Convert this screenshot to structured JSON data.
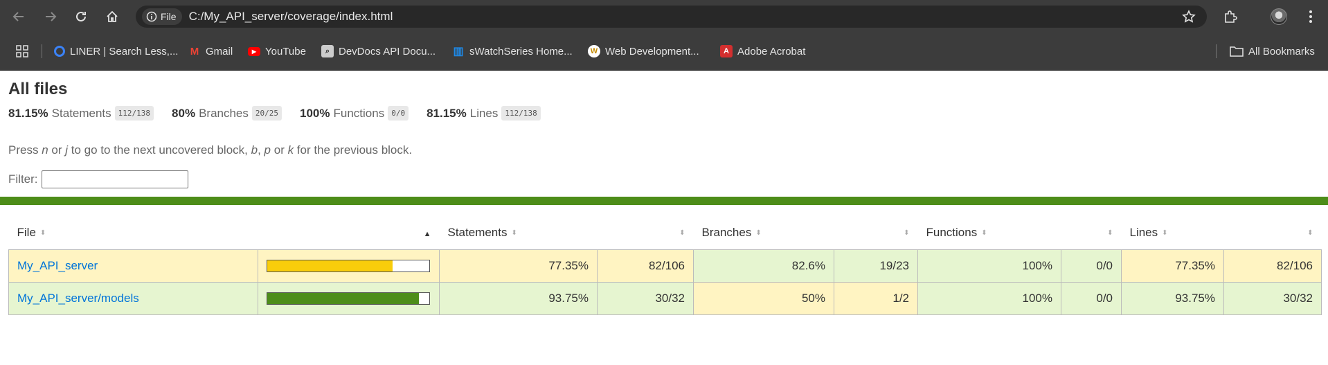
{
  "browser": {
    "url": "C:/My_API_server/coverage/index.html",
    "site_chip": "File",
    "bookmarks": [
      {
        "label": "LINER | Search Less,...",
        "icon": "liner-icon",
        "color": "#3b82f6"
      },
      {
        "label": "Gmail",
        "icon": "gmail-icon",
        "color": "#ea4335"
      },
      {
        "label": "YouTube",
        "icon": "youtube-icon",
        "color": "#ff0000"
      },
      {
        "label": "DevDocs API Docu...",
        "icon": "devdocs-icon",
        "color": "#cccccc"
      },
      {
        "label": "sWatchSeries Home...",
        "icon": "swatchseries-icon",
        "color": "#1e88e5"
      },
      {
        "label": "Web Development...",
        "icon": "webdev-icon",
        "color": "#f4c20d"
      },
      {
        "label": "Adobe Acrobat",
        "icon": "acrobat-icon",
        "color": "#d32f2f"
      }
    ],
    "all_bookmarks": "All Bookmarks"
  },
  "report": {
    "title": "All files",
    "summary": [
      {
        "pct": "81.15%",
        "label": "Statements",
        "fraction": "112/138"
      },
      {
        "pct": "80%",
        "label": "Branches",
        "fraction": "20/25"
      },
      {
        "pct": "100%",
        "label": "Functions",
        "fraction": "0/0"
      },
      {
        "pct": "81.15%",
        "label": "Lines",
        "fraction": "112/138"
      }
    ],
    "hint": {
      "p1": "Press ",
      "k1": "n",
      "p2": " or ",
      "k2": "j",
      "p3": " to go to the next uncovered block, ",
      "k3": "b",
      "p4": ", ",
      "k4": "p",
      "p5": " or ",
      "k5": "k",
      "p6": " for the previous block."
    },
    "filter_label": "Filter:",
    "filter_value": "",
    "columns": {
      "file": "File",
      "sort_up": "▲",
      "statements": "Statements",
      "branches": "Branches",
      "functions": "Functions",
      "lines": "Lines"
    },
    "rows": [
      {
        "file": "My_API_server",
        "stmt_pct": "77.35%",
        "stmt_frac": "82/106",
        "branch_pct": "82.6%",
        "branch_frac": "19/23",
        "func_pct": "100%",
        "func_frac": "0/0",
        "line_pct": "77.35%",
        "line_frac": "82/106",
        "coverage_fraction": 0.7735
      },
      {
        "file": "My_API_server/models",
        "stmt_pct": "93.75%",
        "stmt_frac": "30/32",
        "branch_pct": "50%",
        "branch_frac": "1/2",
        "func_pct": "100%",
        "func_frac": "0/0",
        "line_pct": "93.75%",
        "line_frac": "30/32",
        "coverage_fraction": 0.9375
      }
    ]
  },
  "colors": {
    "medium_bar": "#f9cd0b",
    "high_bar": "#4d8d19",
    "low_bg": "#fff4c2",
    "high_bg": "#e6f5d0"
  }
}
